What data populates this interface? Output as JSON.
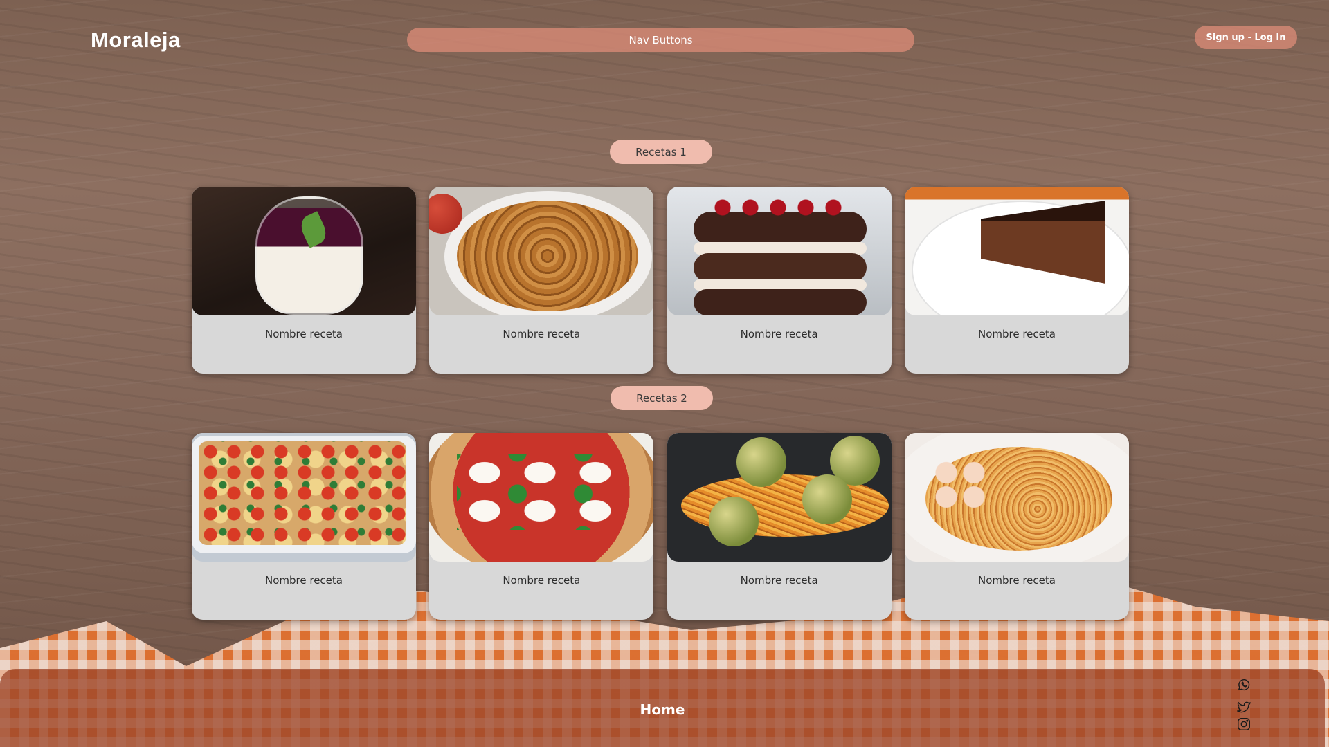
{
  "header": {
    "logo": "Moraleja",
    "nav_label": "Nav Buttons",
    "auth_label": "Sign up - Log In"
  },
  "sections": [
    {
      "label": "Recetas 1",
      "cards": [
        {
          "title": "Nombre receta",
          "image": "panna-cotta-berries"
        },
        {
          "title": "Nombre receta",
          "image": "apple-pie"
        },
        {
          "title": "Nombre receta",
          "image": "black-forest-cake"
        },
        {
          "title": "Nombre receta",
          "image": "chocolate-cake-slice"
        }
      ]
    },
    {
      "label": "Recetas 2",
      "cards": [
        {
          "title": "Nombre receta",
          "image": "vegetable-casserole"
        },
        {
          "title": "Nombre receta",
          "image": "margherita-pizza"
        },
        {
          "title": "Nombre receta",
          "image": "veggie-balls-pasta"
        },
        {
          "title": "Nombre receta",
          "image": "shrimp-spaghetti"
        }
      ]
    }
  ],
  "footer": {
    "home_label": "Home",
    "social": [
      "whatsapp-icon",
      "twitter-icon",
      "instagram-icon"
    ]
  },
  "colors": {
    "accent_pill": "#f0bcae",
    "nav_bar": "#de8c78",
    "footer": "#9e482c",
    "card": "#d8d8d8"
  }
}
